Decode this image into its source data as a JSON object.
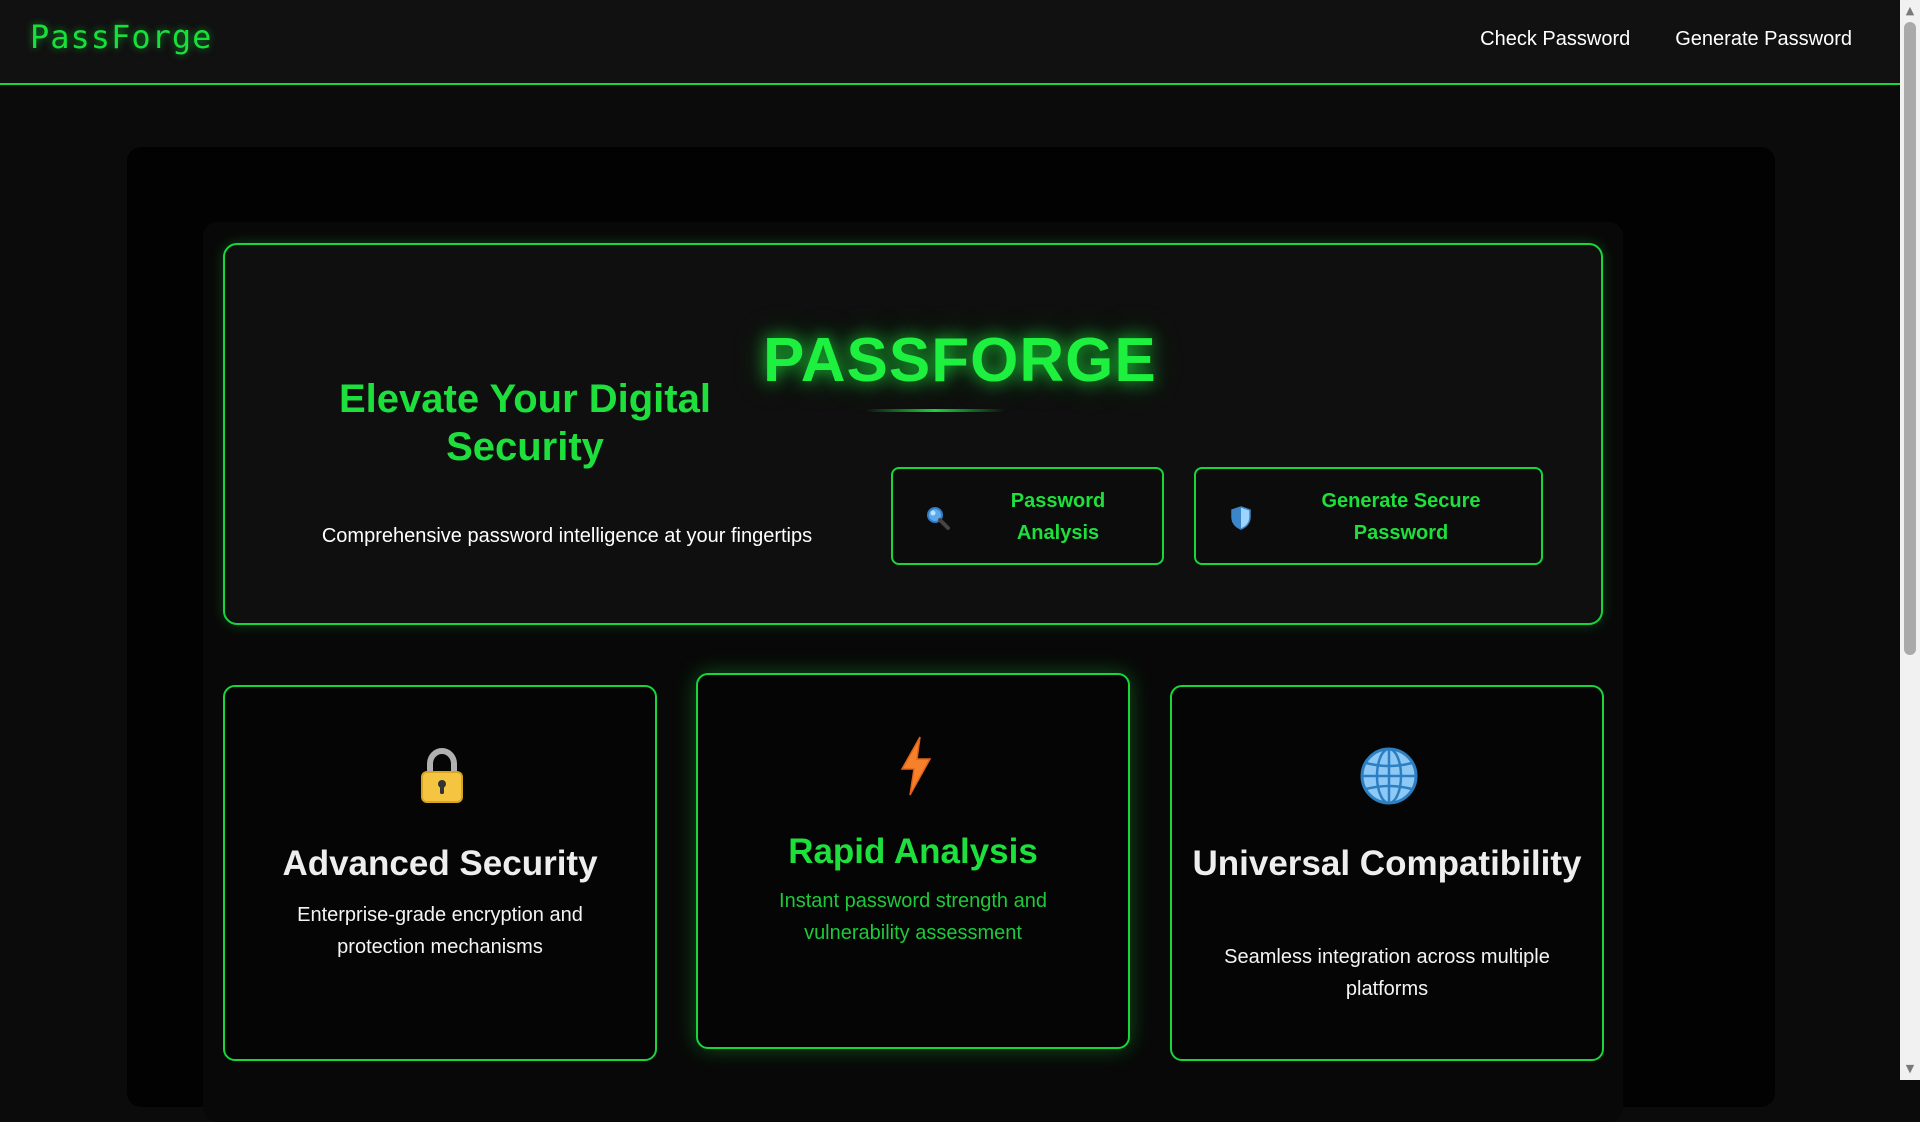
{
  "nav": {
    "brand": "PassForge",
    "links": [
      "Check Password",
      "Generate Password"
    ]
  },
  "hero": {
    "brand": "PASSFORGE",
    "headline": "Elevate Your Digital Security",
    "subtitle": "Comprehensive password intelligence at your fingertips",
    "buttons": [
      {
        "label": "Password Analysis",
        "icon": "magnifier-icon"
      },
      {
        "label": "Generate Secure Password",
        "icon": "shield-icon"
      }
    ]
  },
  "features": [
    {
      "icon": "lock-icon",
      "title": "Advanced Security",
      "description": "Enterprise-grade encryption and protection mechanisms"
    },
    {
      "icon": "lightning-icon",
      "title": "Rapid Analysis",
      "description": "Instant password strength and vulnerability assessment"
    },
    {
      "icon": "globe-icon",
      "title": "Universal Compatibility",
      "description": "Seamless integration across multiple platforms"
    }
  ],
  "colors": {
    "accent": "#18d63a",
    "background": "#0b0b0b",
    "text": "#ffffff"
  }
}
